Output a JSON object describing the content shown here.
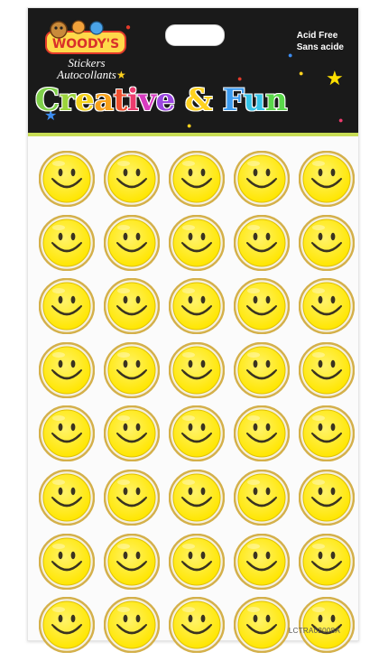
{
  "header": {
    "brand": "WOODY'S",
    "brand_lines": [
      "Stickers",
      "Autocollants"
    ],
    "acid_lines": [
      "Acid Free",
      "Sans acide"
    ],
    "title_parts": [
      {
        "text": "C",
        "color": "#7fd04a"
      },
      {
        "text": "r",
        "color": "#9bd43b"
      },
      {
        "text": "e",
        "color": "#f3d21a"
      },
      {
        "text": "a",
        "color": "#f7a11a"
      },
      {
        "text": "t",
        "color": "#ef4f2f"
      },
      {
        "text": "i",
        "color": "#ec3b6e"
      },
      {
        "text": "v",
        "color": "#d73ac0"
      },
      {
        "text": "e",
        "color": "#9b46e0"
      },
      {
        "text": " & ",
        "color": "#ffd21f"
      },
      {
        "text": "F",
        "color": "#3b9bf0"
      },
      {
        "text": "u",
        "color": "#35c4e8"
      },
      {
        "text": "n",
        "color": "#5ad84a"
      }
    ]
  },
  "stickers": {
    "rows": 8,
    "columns": 5,
    "icon": "smiley-face",
    "face_color": "#ffe600",
    "rim_color": "#d4b04a"
  },
  "product_code": "LCTRA02008A"
}
